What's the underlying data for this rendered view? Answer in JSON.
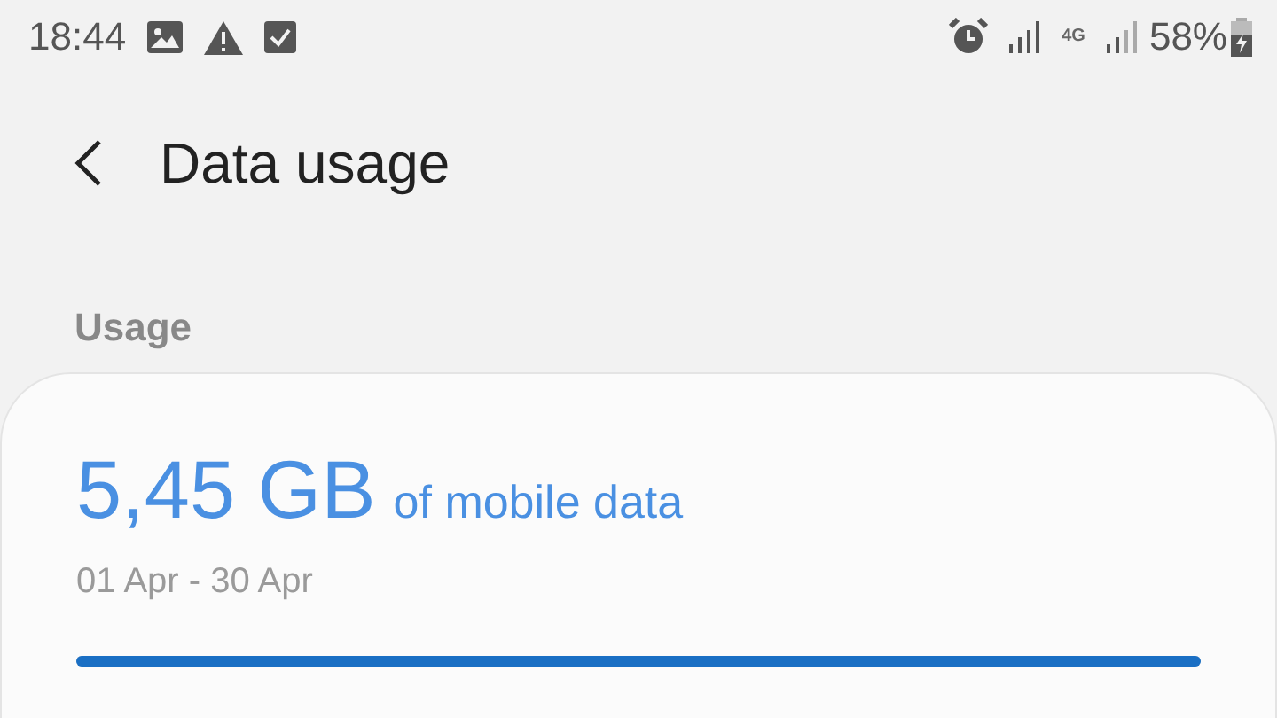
{
  "status_bar": {
    "time": "18:44",
    "network": "4G",
    "battery": "58%"
  },
  "header": {
    "title": "Data usage"
  },
  "section": {
    "label": "Usage"
  },
  "usage_card": {
    "amount": "5,45 GB",
    "unit_label": "of mobile data",
    "period": "01 Apr - 30 Apr",
    "level": 1
  }
}
